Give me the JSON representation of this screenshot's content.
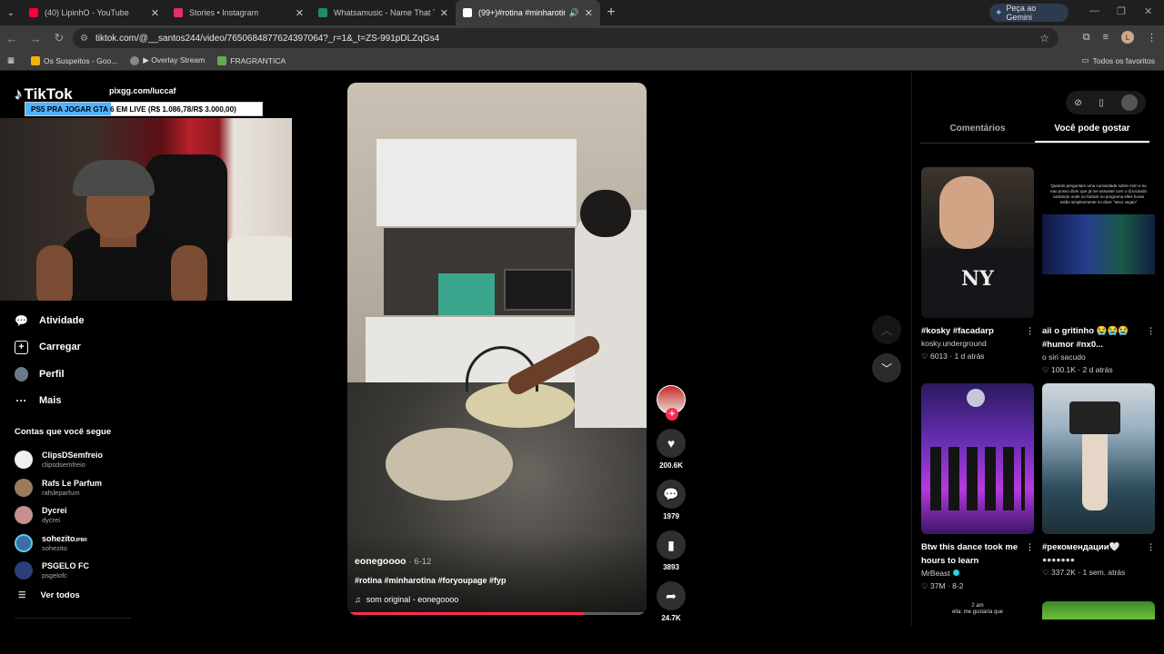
{
  "browser": {
    "tabs": [
      {
        "title": "(40) LipinhO - YouTube",
        "favicon_color": "#ff0033",
        "active": false
      },
      {
        "title": "Stories • Instagram",
        "favicon_color": "#e1306c",
        "active": false
      },
      {
        "title": "Whatsamusic - Name That Tune",
        "favicon_color": "#1f8a70",
        "active": false
      },
      {
        "title": "(99+)#rotina #minharotina",
        "favicon_color": "#ffffff",
        "active": true
      }
    ],
    "gemini_label": "Peça ao Gemini",
    "url": "tiktok.com/@__santos244/video/7650684877624397064?_r=1&_t=ZS-991pDLZqGs4",
    "profile_initial": "L",
    "bookmarks": [
      "Os Suspeitos - Goo...",
      "▶ Overlay Stream",
      "FRAGRANTICA"
    ],
    "all_bookmarks_label": "Todos os favoritos"
  },
  "tiktok": {
    "logo_text": "TikTok",
    "overlay": {
      "pix_text": "pixgg.com/luccaf",
      "banner_text": "PS5 PRA JOGAR GTA 6 EM LIVE (R$ 1.086,78/R$ 3.000,00)",
      "banner_progress": 0.362
    },
    "nav": [
      {
        "label": "Atividade",
        "icon": "activity-icon"
      },
      {
        "label": "Carregar",
        "icon": "upload-icon"
      },
      {
        "label": "Perfil",
        "icon": "profile-avatar"
      },
      {
        "label": "Mais",
        "icon": "more-icon"
      }
    ],
    "following_title": "Contas que você segue",
    "following": [
      {
        "name": "ClipsDSemfreio",
        "handle": "clipsdsemfreio",
        "color": "#f0f0f0"
      },
      {
        "name": "Rafs Le Parfum",
        "handle": "rafsleparfum",
        "color": "#9c7a5e"
      },
      {
        "name": "Dycrei",
        "handle": "dycrei",
        "color": "#c88f8f"
      },
      {
        "name": "sohezito",
        "name_sup": "JPBR",
        "handle": "sohezito",
        "color": "#3a6ea5"
      },
      {
        "name": "PSGELO FC",
        "handle": "psgelofc",
        "color": "#2b3e7a"
      }
    ],
    "see_all": "Ver todos",
    "video": {
      "author": "eonegoooo",
      "date": "6-12",
      "hashtags": "#rotina #minharotina #foryoupage #fyp",
      "sound": "som original - eonegoooo",
      "progress": 0.79
    },
    "actions": [
      {
        "icon": "heart-icon",
        "glyph": "♥",
        "count": "200.6K"
      },
      {
        "icon": "comment-icon",
        "glyph": "●",
        "count": "1979"
      },
      {
        "icon": "bookmark-icon",
        "glyph": "▮",
        "count": "3893"
      },
      {
        "icon": "share-icon",
        "glyph": "➦",
        "count": "24.7K"
      }
    ],
    "right_tabs": [
      "Comentários",
      "Você pode gostar"
    ],
    "suggestions": [
      {
        "title": "#kosky #facadarp",
        "author": "kosky.underground",
        "likes": "6013",
        "age": "1 d atrás",
        "thumb_text": "NY"
      },
      {
        "title": "aii o gritinho 😭😭😭 #humor #nx0...",
        "author": "o siri sacudo",
        "likes": "100.1K",
        "age": "2 d atrás",
        "thumb_text": "Quando perguntam uma curiosidade sobre mim e eu nao posso dizer que já me assustei com o dj tocando cantando onde ou faziam no programa elles horas estão simplesmente no dizer \"sexo vegan\""
      },
      {
        "title": "Btw this dance took me hours to learn",
        "author": "MrBeast",
        "likes": "37M",
        "age": "8-2"
      },
      {
        "title": "#рекомендации🤍",
        "author": "●●●●●●●",
        "likes": "337.2K",
        "age": "1 sem. atrás"
      },
      {
        "thumb_text": "2 am\nella: me gustaría que"
      }
    ]
  }
}
